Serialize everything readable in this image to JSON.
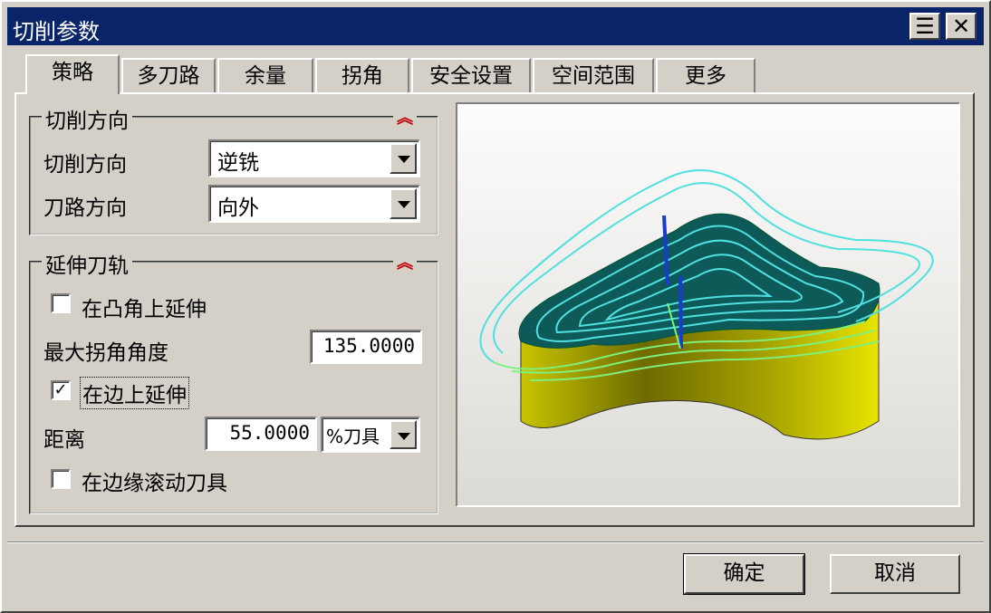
{
  "window": {
    "title": "切削参数",
    "menu_icon": "menu-icon",
    "close_icon": "close-icon"
  },
  "tabs": [
    {
      "label": "策略",
      "selected": true
    },
    {
      "label": "多刀路"
    },
    {
      "label": "余量"
    },
    {
      "label": "拐角"
    },
    {
      "label": "安全设置"
    },
    {
      "label": "空间范围"
    },
    {
      "label": "更多"
    }
  ],
  "cut_direction_group": {
    "title": "切削方向",
    "collapse_icon": "double-chevron-up-icon",
    "cut_direction": {
      "label": "切削方向",
      "value": "逆铣"
    },
    "path_direction": {
      "label": "刀路方向",
      "value": "向外"
    }
  },
  "extend_group": {
    "title": "延伸刀轨",
    "collapse_icon": "double-chevron-up-icon",
    "extend_convex": {
      "label": "在凸角上延伸",
      "checked": false
    },
    "max_corner_angle": {
      "label": "最大拐角角度",
      "value": "135.0000"
    },
    "extend_edge": {
      "label": "在边上延伸",
      "checked": true
    },
    "distance": {
      "label": "距离",
      "value": "55.0000",
      "unit": "%刀具"
    },
    "roll_tool": {
      "label": "在边缘滚动刀具",
      "checked": false
    }
  },
  "buttons": {
    "ok": "确定",
    "cancel": "取消"
  }
}
